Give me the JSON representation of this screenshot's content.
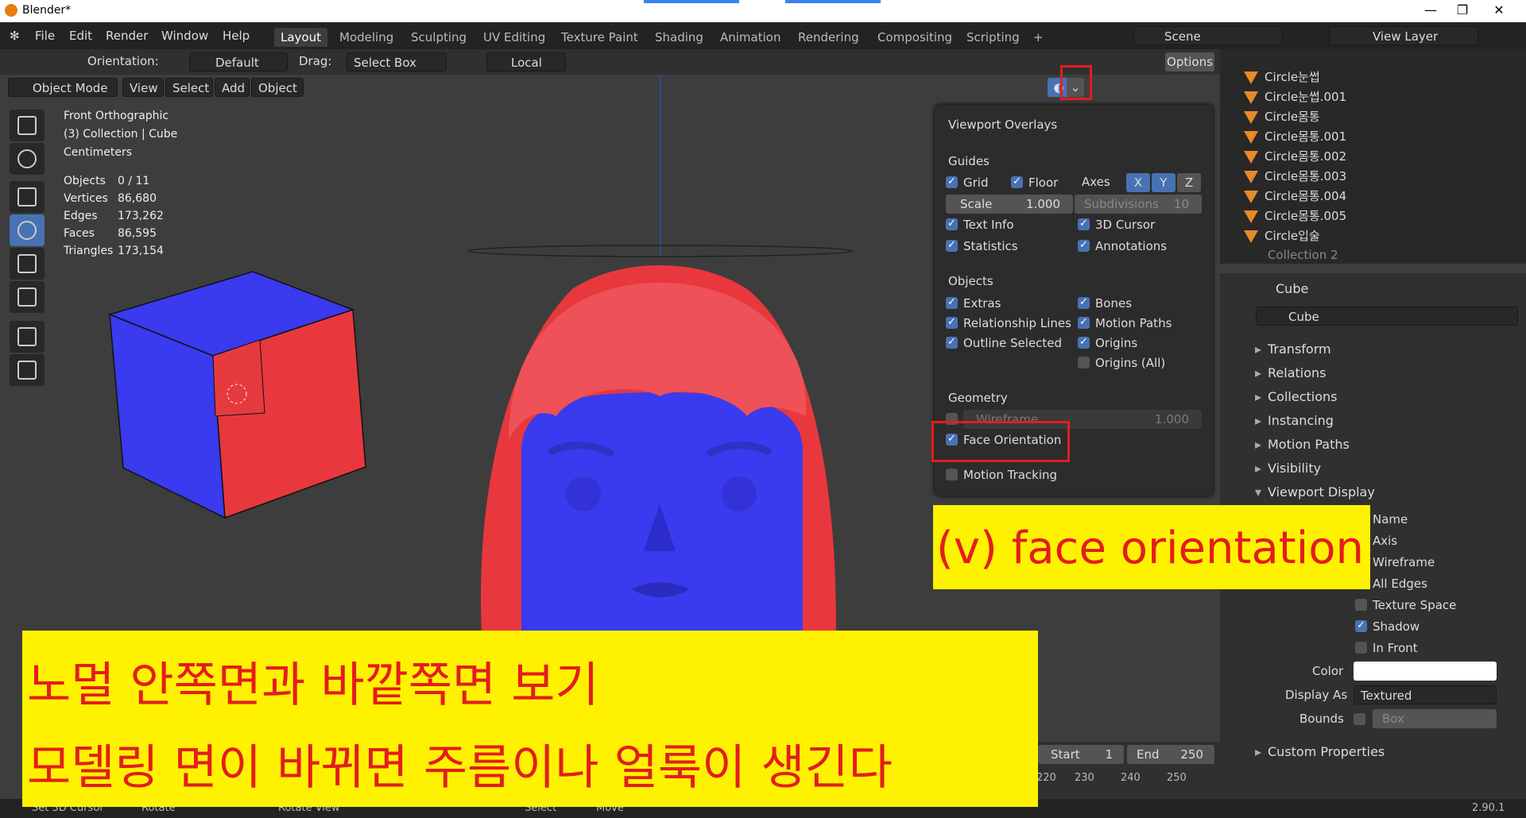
{
  "window": {
    "title": "Blender*",
    "version": "2.90.1"
  },
  "menu": [
    "File",
    "Edit",
    "Render",
    "Window",
    "Help"
  ],
  "workspaces": [
    "Layout",
    "Modeling",
    "Sculpting",
    "UV Editing",
    "Texture Paint",
    "Shading",
    "Animation",
    "Rendering",
    "Compositing",
    "Scripting",
    "+"
  ],
  "scene": {
    "scene_label": "Scene",
    "view_layer": "View Layer"
  },
  "header": {
    "orientation_label": "Orientation:",
    "orientation_value": "Default",
    "drag_label": "Drag:",
    "drag_value": "Select Box",
    "pivot_value": "Local",
    "options": "Options"
  },
  "viewport_header": {
    "mode": "Object Mode",
    "items": [
      "View",
      "Select",
      "Add",
      "Object"
    ]
  },
  "viewport_info": {
    "view": "Front Orthographic",
    "collection": "(3) Collection | Cube",
    "units": "Centimeters",
    "stats": [
      {
        "label": "Objects",
        "value": "0 / 11"
      },
      {
        "label": "Vertices",
        "value": "86,680"
      },
      {
        "label": "Edges",
        "value": "173,262"
      },
      {
        "label": "Faces",
        "value": "86,595"
      },
      {
        "label": "Triangles",
        "value": "173,154"
      }
    ]
  },
  "overlays": {
    "title": "Viewport Overlays",
    "guides": "Guides",
    "grid": "Grid",
    "floor": "Floor",
    "axes": "Axes",
    "x": "X",
    "y": "Y",
    "z": "Z",
    "scale_label": "Scale",
    "scale_value": "1.000",
    "subdiv_label": "Subdivisions",
    "subdiv_value": "10",
    "text_info": "Text Info",
    "cursor3d": "3D Cursor",
    "statistics": "Statistics",
    "annotations": "Annotations",
    "objects": "Objects",
    "extras": "Extras",
    "bones": "Bones",
    "relationship_lines": "Relationship Lines",
    "motion_paths": "Motion Paths",
    "outline_selected": "Outline Selected",
    "origins": "Origins",
    "origins_all": "Origins (All)",
    "geometry": "Geometry",
    "wireframe": "Wireframe",
    "wireframe_value": "1.000",
    "face_orientation": "Face Orientation",
    "motion_tracking": "Motion Tracking"
  },
  "outliner": {
    "items": [
      "Circle눈썹",
      "Circle눈썹.001",
      "Circle몸통",
      "Circle몸통.001",
      "Circle몸통.002",
      "Circle몸통.003",
      "Circle몸통.004",
      "Circle몸통.005",
      "Circle입술"
    ],
    "collection2": "Collection 2"
  },
  "properties": {
    "object": "Cube",
    "object_field": "Cube",
    "sections": [
      "Transform",
      "Relations",
      "Collections",
      "Instancing",
      "Motion Paths",
      "Visibility",
      "Viewport Display"
    ],
    "vd_items": [
      "Name",
      "Axis",
      "Wireframe",
      "All Edges",
      "Texture Space",
      "Shadow",
      "In Front"
    ],
    "color_label": "Color",
    "display_as_label": "Display As",
    "display_as_value": "Textured",
    "bounds_label": "Bounds",
    "bounds_value": "Box",
    "custom_props": "Custom Properties"
  },
  "timeline": {
    "start_label": "Start",
    "start": "1",
    "end_label": "End",
    "end": "250",
    "ticks": [
      "220",
      "230",
      "240",
      "250"
    ]
  },
  "status": {
    "items": [
      "Set 3D Cursor",
      "Rotate",
      "Rotate View",
      "Select",
      "Move"
    ]
  },
  "annotations": {
    "face_orientation_note": "(v) face orientation",
    "korean_line1": "노멀 안쪽면과 바깥쪽면 보기",
    "korean_line2": "모델링 면이 바뀌면 주름이나 얼룩이 생긴다"
  },
  "colors": {
    "front_face": "#3a3aee",
    "back_face": "#e8383d",
    "accent": "#4772b3",
    "highlight": "#e31d1d",
    "note_bg": "#fff200"
  }
}
